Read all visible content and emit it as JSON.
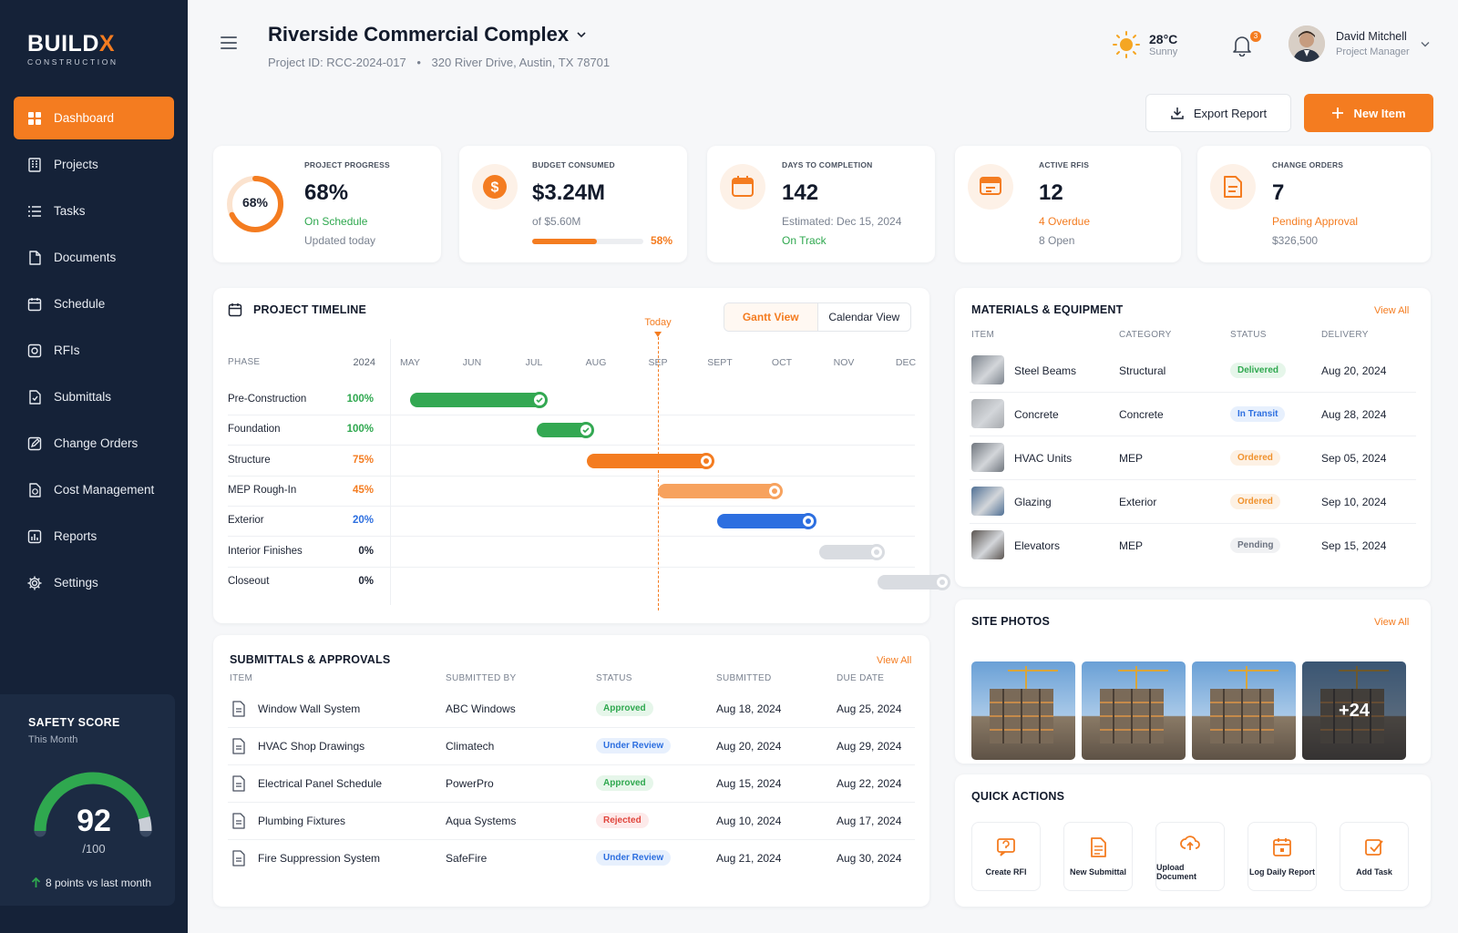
{
  "brand": {
    "name_a": "BUILD",
    "name_b": "X",
    "tagline": "CONSTRUCTION",
    "accent": "#f47c20",
    "sidebar_bg": "#152238"
  },
  "nav": [
    {
      "label": "Dashboard",
      "icon": "grid-icon",
      "active": true
    },
    {
      "label": "Projects",
      "icon": "building-icon"
    },
    {
      "label": "Tasks",
      "icon": "list-icon"
    },
    {
      "label": "Documents",
      "icon": "document-icon"
    },
    {
      "label": "Schedule",
      "icon": "calendar-icon"
    },
    {
      "label": "RFIs",
      "icon": "rfi-icon"
    },
    {
      "label": "Submittals",
      "icon": "submittal-icon"
    },
    {
      "label": "Change Orders",
      "icon": "edit-icon"
    },
    {
      "label": "Cost Management",
      "icon": "dollar-doc-icon"
    },
    {
      "label": "Reports",
      "icon": "report-icon"
    },
    {
      "label": "Settings",
      "icon": "gear-icon"
    }
  ],
  "safety": {
    "title": "SAFETY SCORE",
    "subtitle": "This Month",
    "score": "92",
    "out_of": "/100",
    "score_value": 92,
    "trend": "8 points vs last month"
  },
  "header": {
    "title": "Riverside Commercial Complex",
    "project_id": "Project ID: RCC-2024-017",
    "address": "320 River Drive, Austin, TX 78701",
    "separator": "•"
  },
  "weather": {
    "temp": "28°C",
    "desc": "Sunny"
  },
  "notifications": {
    "count": "3"
  },
  "user": {
    "name": "David Mitchell",
    "role": "Project Manager"
  },
  "actions": {
    "export": "Export Report",
    "new_item": "New Item"
  },
  "kpis": {
    "progress": {
      "label": "PROJECT PROGRESS",
      "value": "68%",
      "ring": "68%",
      "ring_value": 68,
      "status": "On Schedule",
      "updated": "Updated today"
    },
    "budget": {
      "label": "BUDGET CONSUMED",
      "value": "$3.24M",
      "of": "of $5.60M",
      "pct": "58%",
      "pct_value": 58
    },
    "days": {
      "label": "DAYS TO COMPLETION",
      "value": "142",
      "estimated": "Estimated: Dec 15, 2024",
      "status": "On Track"
    },
    "rfis": {
      "label": "ACTIVE RFIS",
      "value": "12",
      "overdue": "4 Overdue",
      "open": "8 Open"
    },
    "change": {
      "label": "CHANGE ORDERS",
      "value": "7",
      "pending": "Pending Approval",
      "amount": "$326,500"
    }
  },
  "timeline": {
    "title": "PROJECT TIMELINE",
    "views": [
      "Gantt View",
      "Calendar View"
    ],
    "phase_header": "PHASE",
    "year": "2024",
    "today": "Today",
    "today_month": 4.0,
    "months": [
      "MAY",
      "JUN",
      "JUL",
      "AUG",
      "SEP",
      "SEPT",
      "OCT",
      "NOV",
      "DEC"
    ],
    "phases": [
      {
        "name": "Pre-Construction",
        "pct": "100%",
        "start": 0.0,
        "end": 2.2,
        "color": "#33a852",
        "pct_color": "#2fa84f"
      },
      {
        "name": "Foundation",
        "pct": "100%",
        "start": 2.05,
        "end": 2.95,
        "color": "#33a852",
        "pct_color": "#2fa84f"
      },
      {
        "name": "Structure",
        "pct": "75%",
        "start": 2.85,
        "end": 4.9,
        "color": "#f47c20",
        "pct_color": "#f47c20"
      },
      {
        "name": "MEP Rough-In",
        "pct": "45%",
        "start": 4.0,
        "end": 6.0,
        "color": "#f7a25e",
        "pct_color": "#f47c20"
      },
      {
        "name": "Exterior",
        "pct": "20%",
        "start": 4.95,
        "end": 6.55,
        "color": "#2d6fe0",
        "pct_color": "#2d6fe0"
      },
      {
        "name": "Interior Finishes",
        "pct": "0%",
        "start": 6.6,
        "end": 7.65,
        "color": "#d9dce1",
        "pct_color": "#1c2333"
      },
      {
        "name": "Closeout",
        "pct": "0%",
        "start": 7.55,
        "end": 8.7,
        "color": "#d9dce1",
        "pct_color": "#1c2333"
      }
    ]
  },
  "submittals": {
    "title": "SUBMITTALS & APPROVALS",
    "view_all": "View All",
    "headers": [
      "ITEM",
      "SUBMITTED BY",
      "STATUS",
      "SUBMITTED",
      "DUE DATE"
    ],
    "rows": [
      {
        "item": "Window Wall System",
        "by": "ABC Windows",
        "status": "Approved",
        "tone": "green",
        "submitted": "Aug 18, 2024",
        "due": "Aug 25, 2024"
      },
      {
        "item": "HVAC Shop Drawings",
        "by": "Climatech",
        "status": "Under Review",
        "tone": "blue",
        "submitted": "Aug 20, 2024",
        "due": "Aug 29, 2024"
      },
      {
        "item": "Electrical Panel Schedule",
        "by": "PowerPro",
        "status": "Approved",
        "tone": "green",
        "submitted": "Aug 15, 2024",
        "due": "Aug 22, 2024"
      },
      {
        "item": "Plumbing Fixtures",
        "by": "Aqua Systems",
        "status": "Rejected",
        "tone": "red",
        "submitted": "Aug 10, 2024",
        "due": "Aug 17, 2024"
      },
      {
        "item": "Fire Suppression System",
        "by": "SafeFire",
        "status": "Under Review",
        "tone": "blue",
        "submitted": "Aug 21, 2024",
        "due": "Aug 30, 2024"
      }
    ]
  },
  "materials": {
    "title": "MATERIALS & EQUIPMENT",
    "view_all": "View All",
    "headers": [
      "ITEM",
      "CATEGORY",
      "STATUS",
      "DELIVERY"
    ],
    "rows": [
      {
        "item": "Steel Beams",
        "category": "Structural",
        "status": "Delivered",
        "tone": "green",
        "delivery": "Aug 20, 2024"
      },
      {
        "item": "Concrete",
        "category": "Concrete",
        "status": "In Transit",
        "tone": "blue",
        "delivery": "Aug 28, 2024"
      },
      {
        "item": "HVAC Units",
        "category": "MEP",
        "status": "Ordered",
        "tone": "orange",
        "delivery": "Sep 05, 2024"
      },
      {
        "item": "Glazing",
        "category": "Exterior",
        "status": "Ordered",
        "tone": "orange",
        "delivery": "Sep 10, 2024"
      },
      {
        "item": "Elevators",
        "category": "MEP",
        "status": "Pending",
        "tone": "gray",
        "delivery": "Sep 15, 2024"
      }
    ]
  },
  "photos": {
    "title": "SITE PHOTOS",
    "view_all": "View All",
    "more": "+24"
  },
  "quick_actions": {
    "title": "QUICK ACTIONS",
    "items": [
      {
        "label": "Create RFI",
        "icon": "rfi-icon"
      },
      {
        "label": "New Submittal",
        "icon": "document-icon"
      },
      {
        "label": "Upload Document",
        "icon": "upload-cloud-icon"
      },
      {
        "label": "Log Daily Report",
        "icon": "calendar-icon"
      },
      {
        "label": "Add Task",
        "icon": "check-square-icon"
      }
    ]
  }
}
